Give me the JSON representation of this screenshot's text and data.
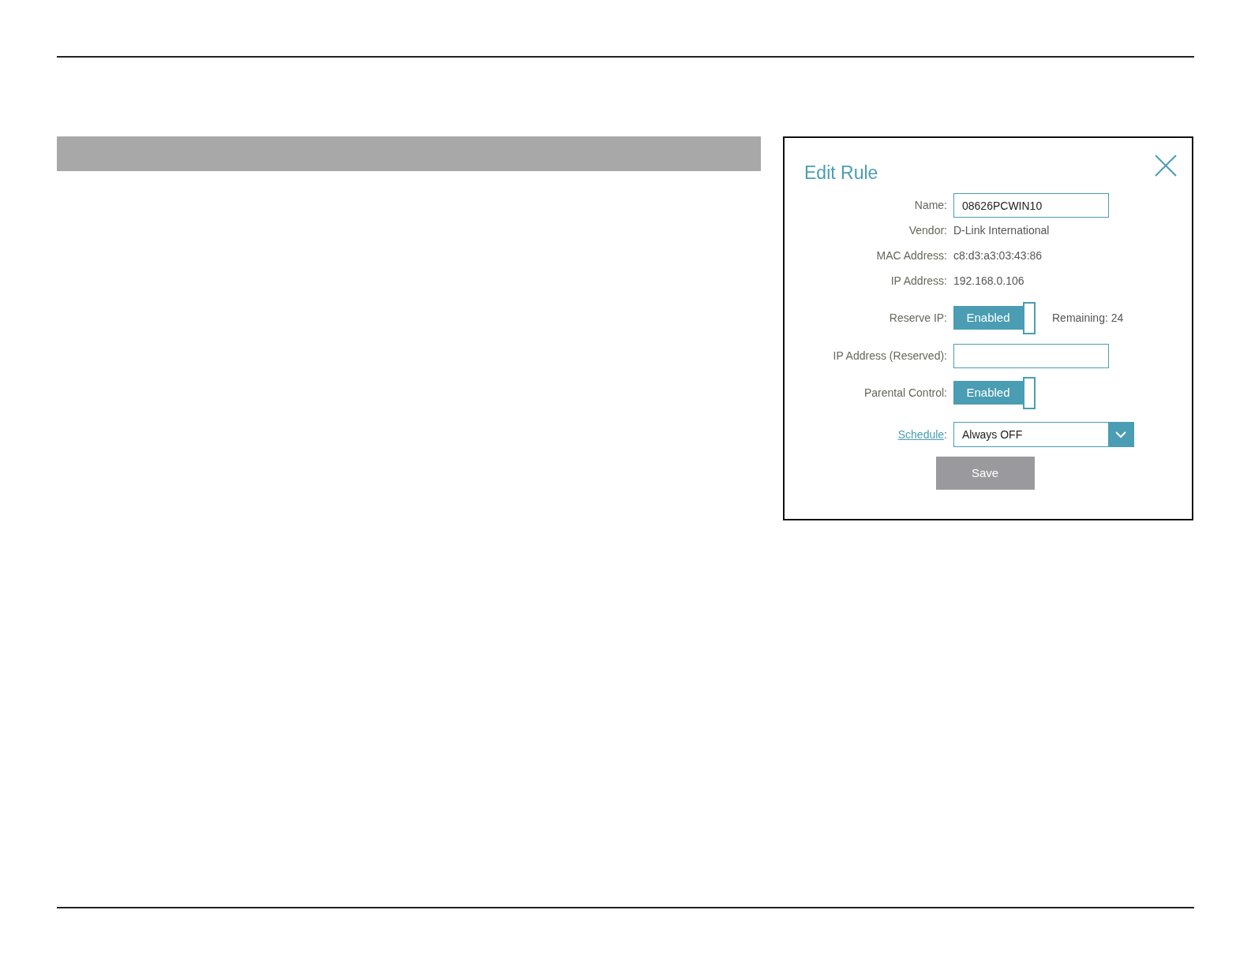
{
  "dialog": {
    "title": "Edit Rule",
    "fields": [
      {
        "kind": "input",
        "label": "Name:",
        "value": "08626PCWIN10"
      },
      {
        "kind": "text",
        "label": "Vendor:",
        "value": "D-Link International"
      },
      {
        "kind": "text",
        "label": "MAC Address:",
        "value": "c8:d3:a3:03:43:86"
      },
      {
        "kind": "text",
        "label": "IP Address:",
        "value": "192.168.0.106"
      },
      {
        "kind": "toggle",
        "label": "Reserve IP:",
        "toggle_label": "Enabled",
        "on": true,
        "note": "Remaining: 24"
      },
      {
        "kind": "input",
        "label": "IP Address (Reserved):"
      },
      {
        "kind": "toggle",
        "label": "Parental Control:",
        "toggle_label": "Enabled",
        "on": true
      },
      {
        "kind": "select",
        "link_label": "Schedule",
        "label_suffix": ":",
        "value": "Always OFF"
      }
    ],
    "save_button": "Save"
  }
}
